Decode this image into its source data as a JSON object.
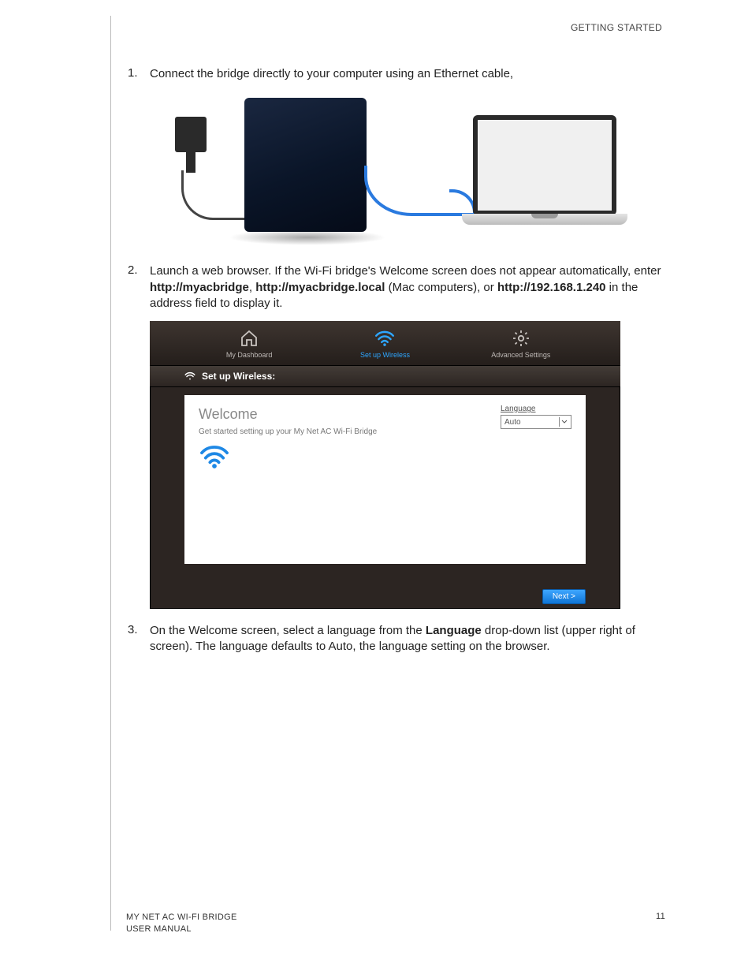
{
  "header": {
    "section": "GETTING STARTED"
  },
  "steps": {
    "s1": {
      "num": "1.",
      "text": "Connect the bridge directly to your computer using an Ethernet cable,"
    },
    "s2": {
      "num": "2.",
      "pre": "Launch a web browser. If the Wi-Fi bridge's Welcome screen does not appear automatically, enter ",
      "b1": "http://myacbridge",
      "mid1": ", ",
      "b2": "http://myacbridge.local",
      "mid2": " (Mac computers), or ",
      "b3": "http://192.168.1.240",
      "post": " in the address field to display it."
    },
    "s3": {
      "num": "3.",
      "pre": "On the Welcome screen, select a language from the ",
      "b1": "Language",
      "post": " drop-down list (upper right of screen). The language defaults to Auto, the language setting on the browser."
    }
  },
  "dashboard": {
    "nav": {
      "dashboard": "My Dashboard",
      "wireless": "Set up Wireless",
      "advanced": "Advanced Settings"
    },
    "subheader": "Set up Wireless:",
    "welcome_title": "Welcome",
    "welcome_sub": "Get started setting up your My Net AC Wi-Fi Bridge",
    "language_label": "Language",
    "language_value": "Auto",
    "next_label": "Next >"
  },
  "footer": {
    "product": "MY NET AC WI-FI BRIDGE",
    "doc": "USER MANUAL",
    "page": "11"
  }
}
